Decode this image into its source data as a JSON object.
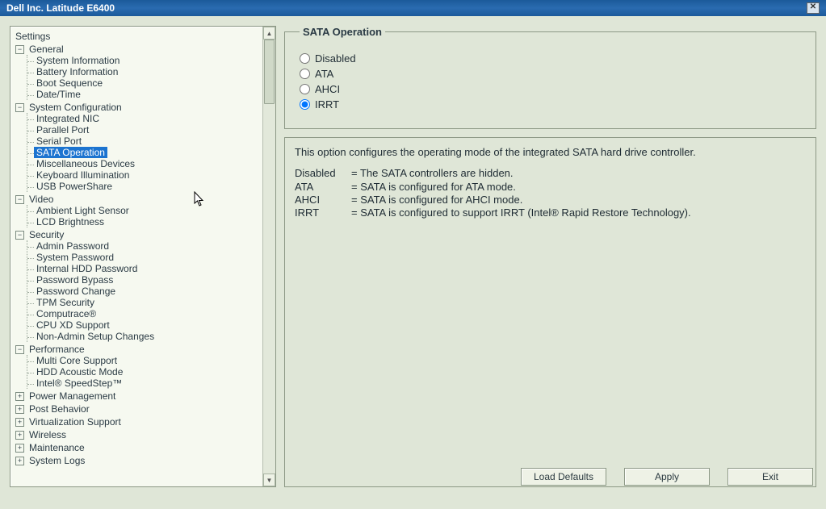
{
  "window": {
    "title": "Dell Inc. Latitude E6400"
  },
  "tree": {
    "heading": "Settings",
    "categories": [
      {
        "id": "general",
        "label": "General",
        "expanded": true,
        "items": [
          "System Information",
          "Battery Information",
          "Boot Sequence",
          "Date/Time"
        ]
      },
      {
        "id": "sysconf",
        "label": "System Configuration",
        "expanded": true,
        "items": [
          "Integrated NIC",
          "Parallel Port",
          "Serial Port",
          "SATA Operation",
          "Miscellaneous Devices",
          "Keyboard Illumination",
          "USB PowerShare"
        ],
        "selectedIndex": 3
      },
      {
        "id": "video",
        "label": "Video",
        "expanded": true,
        "items": [
          "Ambient Light Sensor",
          "LCD Brightness"
        ]
      },
      {
        "id": "security",
        "label": "Security",
        "expanded": true,
        "items": [
          "Admin Password",
          "System Password",
          "Internal HDD Password",
          "Password Bypass",
          "Password Change",
          "TPM Security",
          "Computrace®",
          "CPU XD Support",
          "Non-Admin Setup Changes"
        ]
      },
      {
        "id": "perf",
        "label": "Performance",
        "expanded": true,
        "items": [
          "Multi Core Support",
          "HDD Acoustic Mode",
          "Intel® SpeedStep™"
        ]
      },
      {
        "id": "power",
        "label": "Power Management",
        "expanded": false,
        "items": []
      },
      {
        "id": "post",
        "label": "Post Behavior",
        "expanded": false,
        "items": []
      },
      {
        "id": "virt",
        "label": "Virtualization Support",
        "expanded": false,
        "items": []
      },
      {
        "id": "wireless",
        "label": "Wireless",
        "expanded": false,
        "items": []
      },
      {
        "id": "maint",
        "label": "Maintenance",
        "expanded": false,
        "items": []
      },
      {
        "id": "logs",
        "label": "System Logs",
        "expanded": false,
        "items": []
      }
    ]
  },
  "panel": {
    "legend": "SATA Operation",
    "options": [
      {
        "value": "disabled",
        "label": "Disabled"
      },
      {
        "value": "ata",
        "label": "ATA"
      },
      {
        "value": "ahci",
        "label": "AHCI"
      },
      {
        "value": "irrt",
        "label": "IRRT"
      }
    ],
    "selected": "irrt",
    "help": {
      "intro": "This option configures the operating mode of the integrated SATA hard drive controller.",
      "rows": [
        {
          "k": "Disabled",
          "v": "= The SATA controllers are hidden."
        },
        {
          "k": "ATA",
          "v": "= SATA is configured for ATA mode."
        },
        {
          "k": "AHCI",
          "v": "= SATA is configured for AHCI mode."
        },
        {
          "k": "IRRT",
          "v": "= SATA is configured to support IRRT (Intel® Rapid Restore Technology)."
        }
      ]
    }
  },
  "buttons": {
    "loadDefaults": "Load Defaults",
    "apply": "Apply",
    "exit": "Exit"
  }
}
